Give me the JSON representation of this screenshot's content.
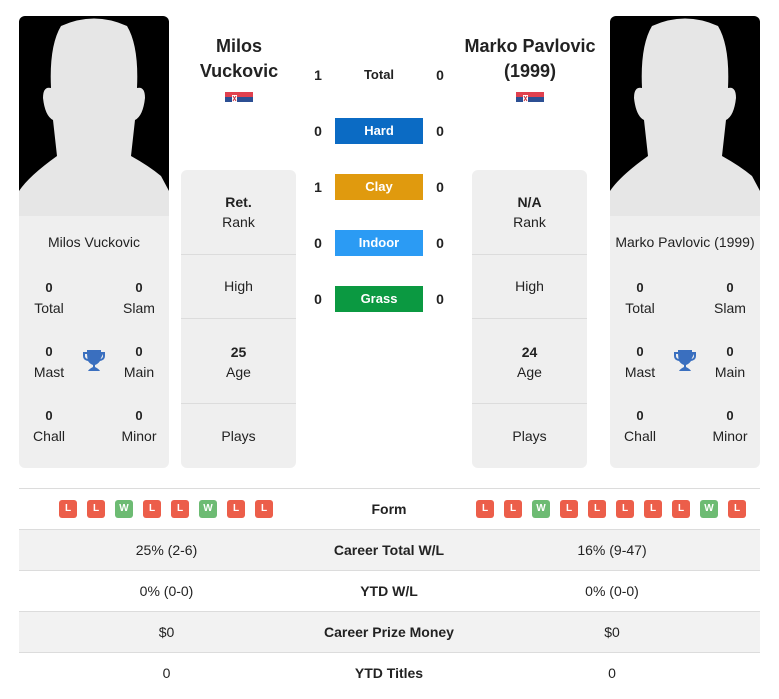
{
  "colors": {
    "hard": "#0b6bc4",
    "clay": "#e09a0e",
    "indoor": "#2b9bf4",
    "grass": "#0b9941",
    "win": "#6dbb73",
    "loss": "#ec5e4a",
    "trophy": "#3a6fbf"
  },
  "player1": {
    "name": "Milos Vuckovic",
    "header_name_line1": "Milos",
    "header_name_line2": "Vuckovic",
    "flag": "serbia-flag",
    "titles": {
      "total": {
        "value": "0",
        "label": "Total"
      },
      "slam": {
        "value": "0",
        "label": "Slam"
      },
      "mast": {
        "value": "0",
        "label": "Mast"
      },
      "main": {
        "value": "0",
        "label": "Main"
      },
      "chall": {
        "value": "0",
        "label": "Chall"
      },
      "minor": {
        "value": "0",
        "label": "Minor"
      }
    },
    "info": {
      "rank": {
        "value": "Ret.",
        "label": "Rank"
      },
      "high": {
        "value": "",
        "label": "High"
      },
      "age": {
        "value": "25",
        "label": "Age"
      },
      "plays": {
        "value": "",
        "label": "Plays"
      }
    },
    "form": [
      "L",
      "L",
      "W",
      "L",
      "L",
      "W",
      "L",
      "L"
    ],
    "career_wl": "25% (2-6)",
    "ytd_wl": "0% (0-0)",
    "prize_money": "$0",
    "ytd_titles": "0"
  },
  "player2": {
    "name": "Marko Pavlovic (1999)",
    "header_name_line1": "Marko Pavlovic",
    "header_name_line2": "(1999)",
    "flag": "serbia-flag",
    "titles": {
      "total": {
        "value": "0",
        "label": "Total"
      },
      "slam": {
        "value": "0",
        "label": "Slam"
      },
      "mast": {
        "value": "0",
        "label": "Mast"
      },
      "main": {
        "value": "0",
        "label": "Main"
      },
      "chall": {
        "value": "0",
        "label": "Chall"
      },
      "minor": {
        "value": "0",
        "label": "Minor"
      }
    },
    "info": {
      "rank": {
        "value": "N/A",
        "label": "Rank"
      },
      "high": {
        "value": "",
        "label": "High"
      },
      "age": {
        "value": "24",
        "label": "Age"
      },
      "plays": {
        "value": "",
        "label": "Plays"
      }
    },
    "form": [
      "L",
      "L",
      "W",
      "L",
      "L",
      "L",
      "L",
      "L",
      "W",
      "L"
    ],
    "career_wl": "16% (9-47)",
    "ytd_wl": "0% (0-0)",
    "prize_money": "$0",
    "ytd_titles": "0"
  },
  "h2h": [
    {
      "label": "Total",
      "p1": "1",
      "p2": "0",
      "surface": "total"
    },
    {
      "label": "Hard",
      "p1": "0",
      "p2": "0",
      "surface": "hard"
    },
    {
      "label": "Clay",
      "p1": "1",
      "p2": "0",
      "surface": "clay"
    },
    {
      "label": "Indoor",
      "p1": "0",
      "p2": "0",
      "surface": "indoor"
    },
    {
      "label": "Grass",
      "p1": "0",
      "p2": "0",
      "surface": "grass"
    }
  ],
  "comparison_labels": {
    "form": "Form",
    "career_wl": "Career Total W/L",
    "ytd_wl": "YTD W/L",
    "prize_money": "Career Prize Money",
    "ytd_titles": "YTD Titles"
  }
}
